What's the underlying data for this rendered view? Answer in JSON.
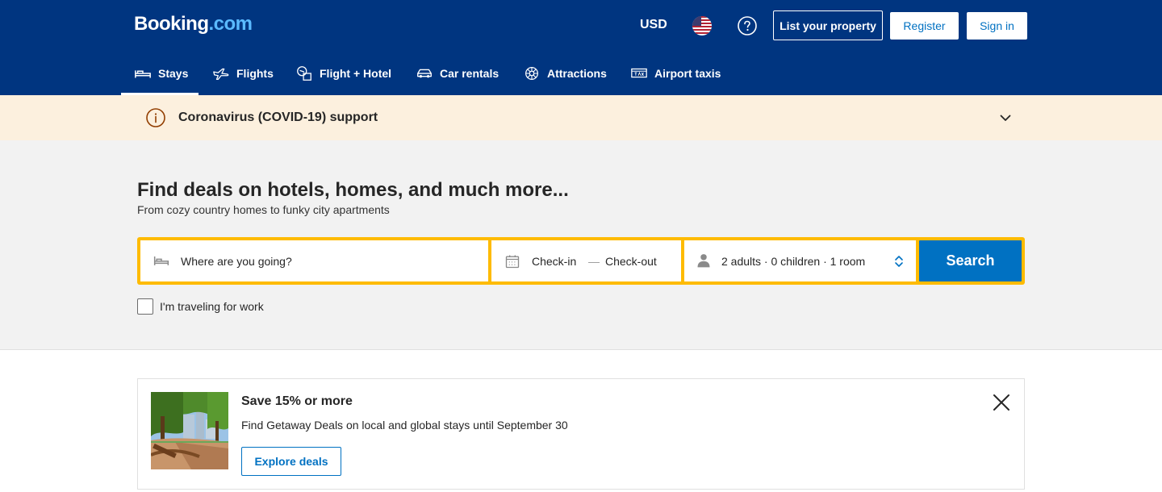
{
  "header": {
    "logo_main": "Booking",
    "logo_suffix": ".com",
    "currency": "USD",
    "list_property": "List your property",
    "register": "Register",
    "sign_in": "Sign in"
  },
  "nav": {
    "items": [
      {
        "label": "Stays",
        "icon": "bed-icon"
      },
      {
        "label": "Flights",
        "icon": "plane-icon"
      },
      {
        "label": "Flight + Hotel",
        "icon": "flight-hotel-icon"
      },
      {
        "label": "Car rentals",
        "icon": "car-icon"
      },
      {
        "label": "Attractions",
        "icon": "attractions-icon"
      },
      {
        "label": "Airport taxis",
        "icon": "taxi-icon"
      }
    ],
    "active": "Stays"
  },
  "covid_banner": {
    "text": "Coronavirus (COVID-19) support"
  },
  "hero": {
    "title": "Find deals on hotels, homes, and much more...",
    "subtitle": "From cozy country homes to funky city apartments"
  },
  "search": {
    "destination_placeholder": "Where are you going?",
    "check_in": "Check-in",
    "separator": "—",
    "check_out": "Check-out",
    "guests": "2 adults · 0 children · 1 room",
    "button": "Search"
  },
  "work_travel": {
    "label": "I'm traveling for work",
    "checked": false
  },
  "promo": {
    "title": "Save 15% or more",
    "description": "Find Getaway Deals on local and global stays until September 30",
    "button": "Explore deals"
  },
  "colors": {
    "brand_blue": "#003580",
    "action_blue": "#0071c2",
    "search_yellow": "#febb02",
    "banner_bg": "#fcf0de"
  }
}
